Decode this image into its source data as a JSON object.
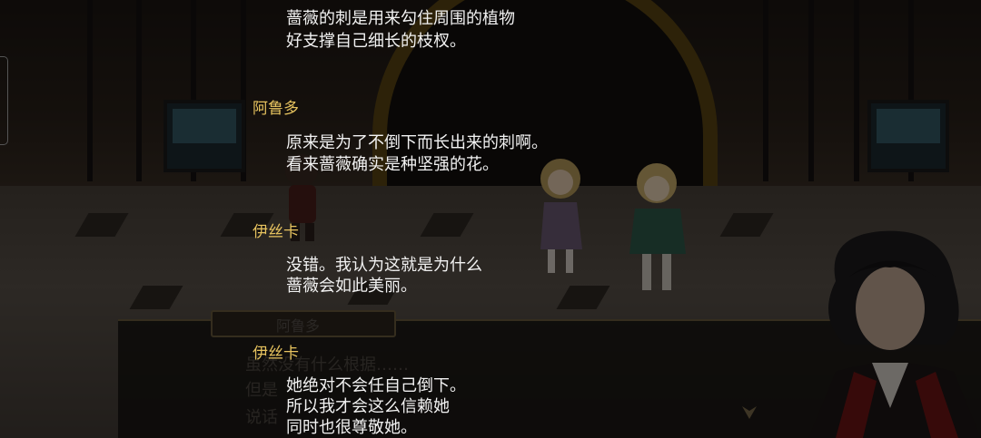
{
  "scene": {
    "npc_name_plate": "阿鲁多",
    "underlying_dialog": [
      "虽然没有什么根据……",
      "但是",
      "说话"
    ],
    "colors": {
      "speaker": "#e7c35f",
      "text": "#f2f2f2",
      "frame_border": "#6b5a3c"
    }
  },
  "backlog": {
    "entries": [
      {
        "speaker": "",
        "lines": [
          "蔷薇的刺是用来勾住周围的植物",
          "好支撑自己细长的枝杈。"
        ]
      },
      {
        "speaker": "阿鲁多",
        "lines": [
          "原来是为了不倒下而长出来的刺啊。",
          "看来蔷薇确实是种坚强的花。"
        ]
      },
      {
        "speaker": "伊丝卡",
        "lines": [
          "没错。我认为这就是为什么",
          "蔷薇会如此美丽。"
        ]
      },
      {
        "speaker": "伊丝卡",
        "lines": [
          "她绝对不会任自己倒下。",
          "所以我才会这么信赖她",
          "同时也很尊敬她。"
        ]
      }
    ]
  }
}
